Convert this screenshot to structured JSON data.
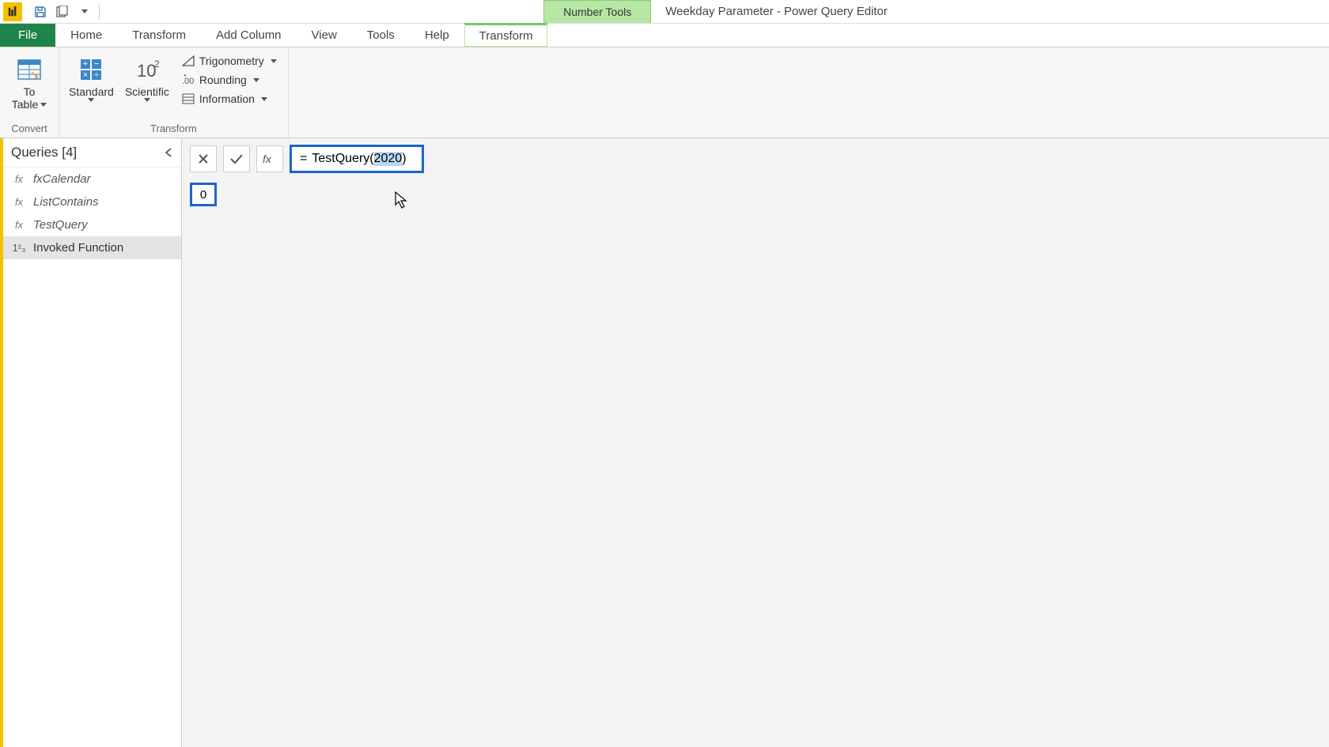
{
  "titlebar": {
    "context_tool_label": "Number Tools",
    "document_title": "Weekday Parameter - Power Query Editor"
  },
  "tabs": {
    "file": "File",
    "home": "Home",
    "transform": "Transform",
    "add_column": "Add Column",
    "view": "View",
    "tools": "Tools",
    "help": "Help",
    "context_transform": "Transform"
  },
  "ribbon": {
    "convert": {
      "to_table_line1": "To",
      "to_table_line2": "Table",
      "group_label": "Convert"
    },
    "transform": {
      "standard": "Standard",
      "scientific": "Scientific",
      "trigonometry": "Trigonometry",
      "rounding": "Rounding",
      "information": "Information",
      "group_label": "Transform"
    }
  },
  "queries": {
    "header": "Queries [4]",
    "items": [
      {
        "icon": "fx",
        "label": "fxCalendar"
      },
      {
        "icon": "fx",
        "label": "ListContains"
      },
      {
        "icon": "fx",
        "label": "TestQuery"
      },
      {
        "icon": "1²₃",
        "label": "Invoked Function"
      }
    ]
  },
  "formula_bar": {
    "prefix": "=",
    "func": "TestQuery(",
    "selected": "2020",
    "suffix": ")"
  },
  "result": {
    "value": "0"
  }
}
